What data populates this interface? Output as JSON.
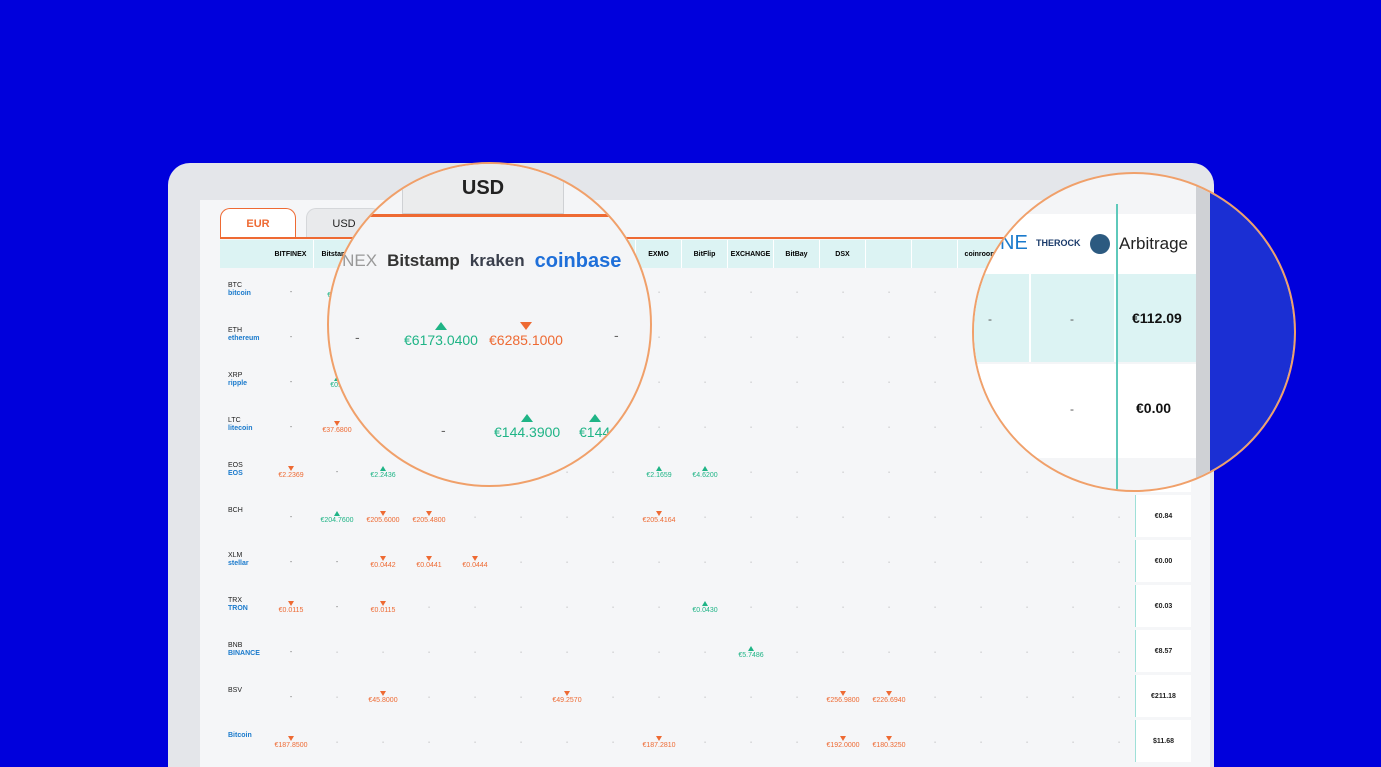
{
  "tabs": [
    {
      "label": "EUR",
      "active": true
    },
    {
      "label": "USD",
      "active": false
    }
  ],
  "exchanges": [
    "BITFINEX",
    "Bitstamp",
    "kraken",
    "coinbase",
    "",
    "",
    "",
    "",
    "EXMO",
    "BitFlip",
    "EXCHANGE",
    "BitBay",
    "DSX",
    "",
    "",
    "coinroom",
    "",
    "THEROCK",
    ""
  ],
  "rows": [
    {
      "code": "BTC",
      "name": "bitcoin",
      "cells": {
        "0": {
          "v": "-"
        },
        "1": {
          "v": "€6285",
          "d": "up"
        }
      },
      "arb": ""
    },
    {
      "code": "ETH",
      "name": "ethereum",
      "cells": {
        "0": {
          "v": "-"
        }
      },
      "arb": ""
    },
    {
      "code": "XRP",
      "name": "ripple",
      "cells": {
        "0": {
          "v": "-"
        },
        "1": {
          "v": "€0.1",
          "d": "up"
        }
      },
      "arb": ""
    },
    {
      "code": "LTC",
      "name": "litecoin",
      "cells": {
        "0": {
          "v": "-"
        },
        "1": {
          "v": "€37.6800",
          "d": "dn"
        }
      },
      "arb": ""
    },
    {
      "code": "EOS",
      "name": "EOS",
      "cells": {
        "0": {
          "v": "€2.2369",
          "d": "dn"
        },
        "1": {
          "v": "-"
        },
        "2": {
          "v": "€2.2436",
          "d": "up"
        },
        "8": {
          "v": "€2.1659",
          "d": "up"
        },
        "9": {
          "v": "€4.6200",
          "d": "up"
        }
      },
      "arb": ""
    },
    {
      "code": "BCH",
      "name": "",
      "cells": {
        "0": {
          "v": "-"
        },
        "1": {
          "v": "€204.7600",
          "d": "up"
        },
        "2": {
          "v": "€205.6000",
          "d": "dn"
        },
        "3": {
          "v": "€205.4800",
          "d": "dn"
        },
        "8": {
          "v": "€205.4164",
          "d": "dn"
        }
      },
      "arb": "€0.84"
    },
    {
      "code": "XLM",
      "name": "stellar",
      "cells": {
        "0": {
          "v": "-"
        },
        "1": {
          "v": "-"
        },
        "2": {
          "v": "€0.0442",
          "d": "dn"
        },
        "3": {
          "v": "€0.0441",
          "d": "dn"
        },
        "4": {
          "v": "€0.0444",
          "d": "dn"
        }
      },
      "arb": "€0.00"
    },
    {
      "code": "TRX",
      "name": "TRON",
      "cells": {
        "0": {
          "v": "€0.0115",
          "d": "dn"
        },
        "1": {
          "v": "-"
        },
        "2": {
          "v": "€0.0115",
          "d": "dn"
        },
        "9": {
          "v": "€0.0430",
          "d": "up"
        }
      },
      "arb": "€0.03"
    },
    {
      "code": "BNB",
      "name": "BINANCE",
      "cells": {
        "0": {
          "v": "-"
        },
        "10": {
          "v": "€5.7486",
          "d": "up"
        }
      },
      "arb": "€8.57"
    },
    {
      "code": "BSV",
      "name": "",
      "cells": {
        "0": {
          "v": "-"
        },
        "2": {
          "v": "€45.8000",
          "d": "dn"
        },
        "6": {
          "v": "€49.2570",
          "d": "dn"
        },
        "12": {
          "v": "€256.9800",
          "d": "dn"
        },
        "13": {
          "v": "€226.6940",
          "d": "dn"
        }
      },
      "arb": "€211.18"
    },
    {
      "code": "",
      "name": "Bitcoin",
      "cells": {
        "0": {
          "v": "€187.8500",
          "d": "dn"
        },
        "8": {
          "v": "€187.2810",
          "d": "dn"
        },
        "12": {
          "v": "€192.0000",
          "d": "dn"
        },
        "13": {
          "v": "€180.3250",
          "d": "dn"
        }
      },
      "arb": "$11.68"
    }
  ],
  "mag1": {
    "tab": "USD",
    "logos": [
      "FINEX",
      "Bitstamp",
      "kraken",
      "coinbase"
    ],
    "values": [
      {
        "v": "-",
        "d": ""
      },
      {
        "v": "€6173.0400",
        "d": "up"
      },
      {
        "v": "€6285.1000",
        "d": "dn"
      },
      {
        "v": "-",
        "d": ""
      },
      {
        "v": "-",
        "d": ""
      },
      {
        "v": "€144.3900",
        "d": "up"
      },
      {
        "v": "€144",
        "d": "up"
      }
    ]
  },
  "mag2": {
    "logos": [
      "NE",
      "THEROCK"
    ],
    "header": "Arbitrage",
    "row1": [
      "-",
      "-",
      "€112.09"
    ],
    "row2": [
      "-",
      "€0.00"
    ]
  }
}
